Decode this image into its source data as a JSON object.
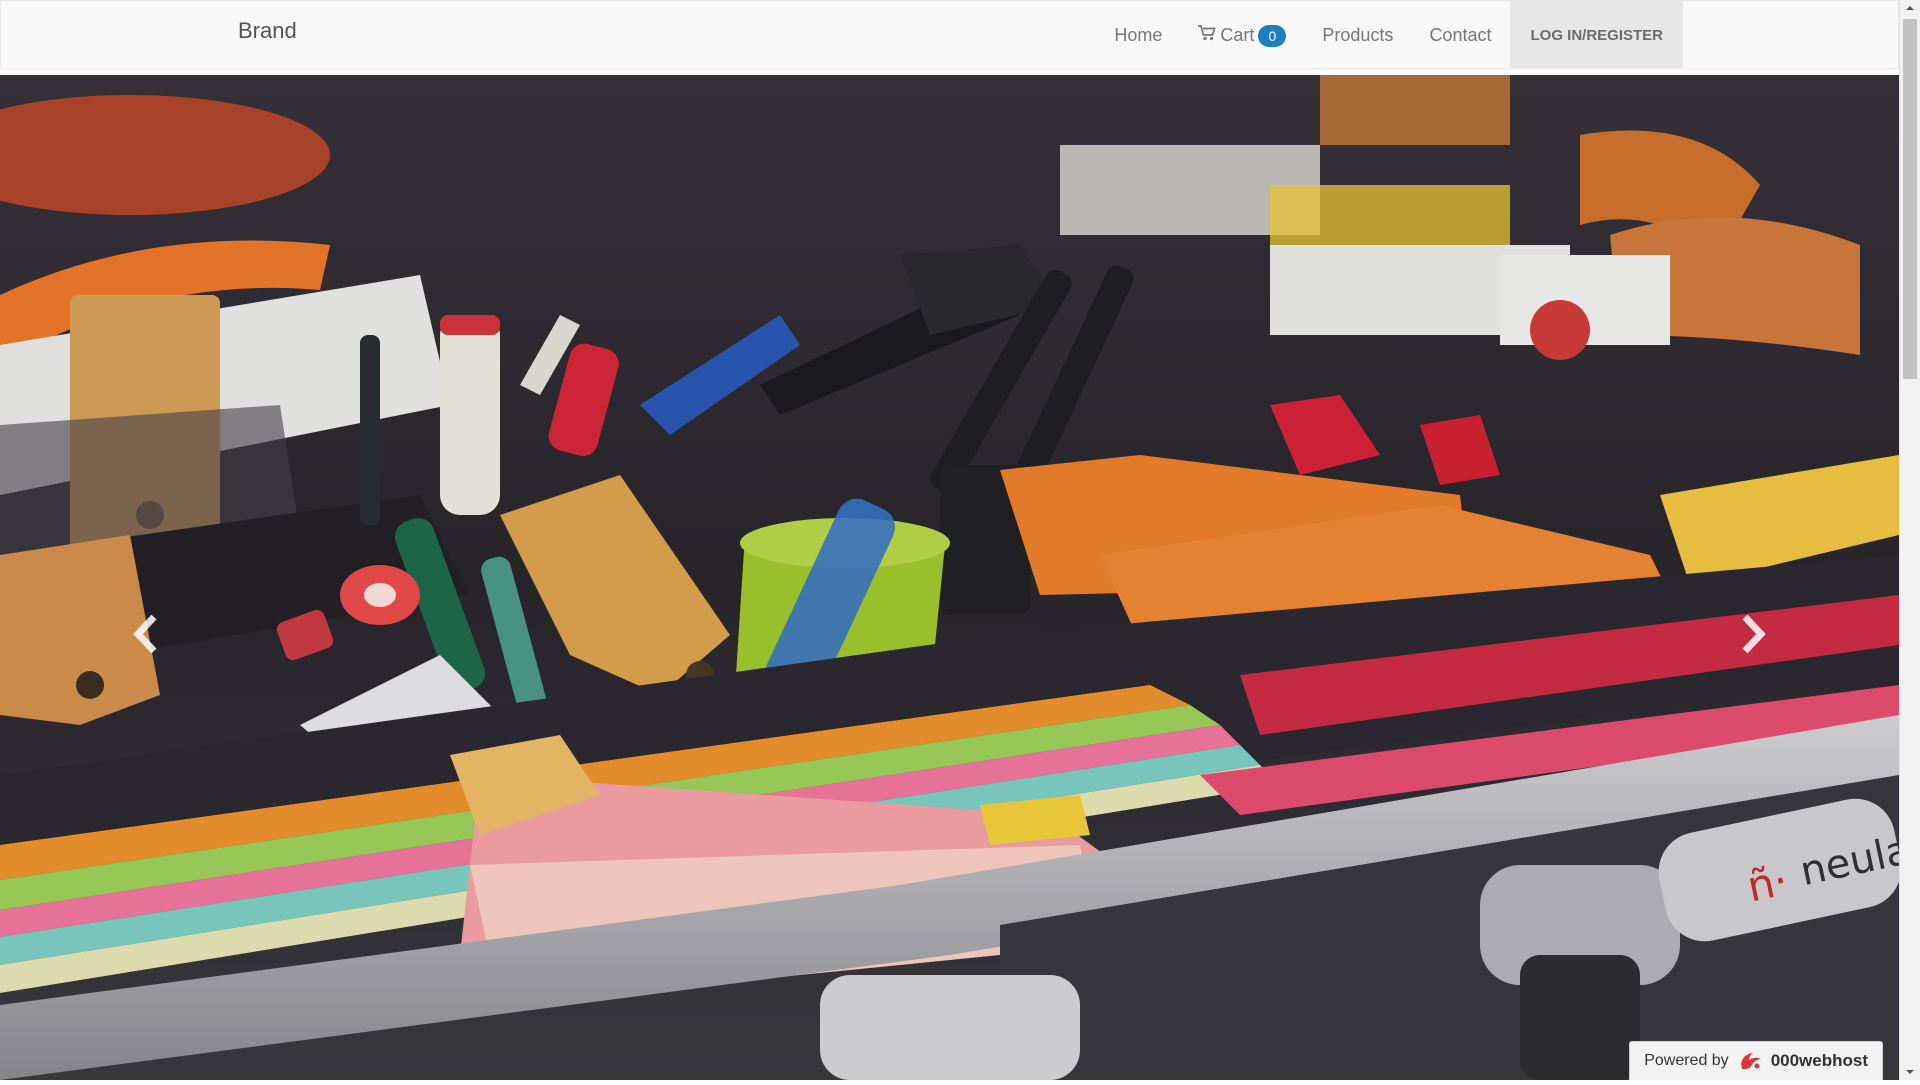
{
  "navbar": {
    "brand": "Brand",
    "links": [
      {
        "label": "Home"
      },
      {
        "label": "Cart",
        "badge": "0"
      },
      {
        "label": "Products"
      },
      {
        "label": "Contact"
      },
      {
        "label": "LOG IN/REGISTER"
      }
    ]
  },
  "carousel": {
    "prev_icon": "chevron-left-icon",
    "next_icon": "chevron-right-icon"
  },
  "footer_badge": {
    "prefix": "Powered by",
    "host": "000webhost"
  },
  "colors": {
    "navbar_bg": "#f8f8f8",
    "badge_bg": "#1c7fbf",
    "login_bg": "#e7e7e7",
    "accent_red": "#d9222f"
  }
}
